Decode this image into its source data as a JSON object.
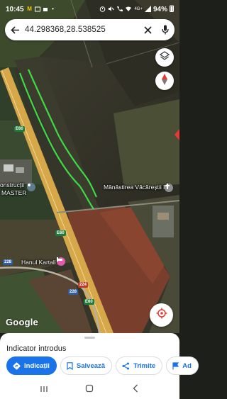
{
  "status_bar": {
    "time": "10:45",
    "battery": "94%",
    "signal_text": "4G+"
  },
  "search": {
    "query": "44.298368,28.538525"
  },
  "map": {
    "labels": {
      "monastery": "Mănăstirea Văcăreștii Noi",
      "construct_line1": "onstrucții",
      "construct_line2": "MASTER",
      "hanul": "Hanul Kartali"
    },
    "shields": {
      "e60_top": "E60",
      "e60_mid": "E60",
      "e60_bottom": "E60",
      "r228_left": "228",
      "r228_mid": "228",
      "r224": "224"
    },
    "logo": "Google",
    "colors": {
      "highway": "#d6a84a",
      "drawn_line": "#3ddc44",
      "accent": "#1a73e8"
    }
  },
  "sheet": {
    "title": "Indicator introdus",
    "actions": [
      {
        "label": "Indicații",
        "icon": "directions-icon"
      },
      {
        "label": "Salvează",
        "icon": "bookmark-icon"
      },
      {
        "label": "Trimite",
        "icon": "share-icon"
      },
      {
        "label": "Ad",
        "icon": "flag-icon"
      }
    ]
  },
  "navbar": {
    "buttons": [
      "recent-apps",
      "home",
      "back"
    ]
  }
}
